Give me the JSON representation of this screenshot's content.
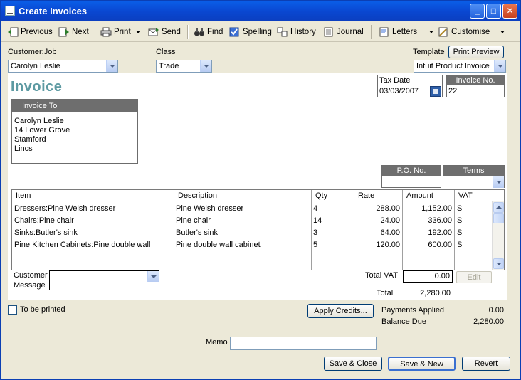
{
  "window": {
    "title": "Create Invoices",
    "min": "_",
    "max": "□",
    "close": "✕"
  },
  "toolbar": {
    "previous": "Previous",
    "next": "Next",
    "print": "Print",
    "send": "Send",
    "find": "Find",
    "spelling": "Spelling",
    "history": "History",
    "journal": "Journal",
    "letters": "Letters",
    "customise": "Customise"
  },
  "header": {
    "customer_job_label": "Customer:Job",
    "customer_job_value": "Carolyn Leslie",
    "class_label": "Class",
    "class_value": "Trade",
    "template_label": "Template",
    "print_preview": "Print Preview",
    "template_value": "Intuit Product Invoice"
  },
  "form": {
    "title": "Invoice",
    "tax_date_label": "Tax Date",
    "tax_date_value": "03/03/2007",
    "invoice_no_label": "Invoice No.",
    "invoice_no_value": "22",
    "invoice_to_label": "Invoice To",
    "invoice_to_lines": [
      "Carolyn Leslie",
      "14 Lower Grove",
      "Stamford",
      "Lincs"
    ],
    "po_label": "P.O. No.",
    "po_value": "",
    "terms_label": "Terms",
    "terms_value": ""
  },
  "items": {
    "columns": [
      "Item",
      "Description",
      "Qty",
      "Rate",
      "Amount",
      "VAT"
    ],
    "rows": [
      {
        "item": "Dressers:Pine Welsh dresser",
        "description": "Pine Welsh dresser",
        "qty": "4",
        "rate": "288.00",
        "amount": "1,152.00",
        "vat": "S"
      },
      {
        "item": "Chairs:Pine chair",
        "description": "Pine chair",
        "qty": "14",
        "rate": "24.00",
        "amount": "336.00",
        "vat": "S"
      },
      {
        "item": "Sinks:Butler's sink",
        "description": "Butler's sink",
        "qty": "3",
        "rate": "64.00",
        "amount": "192.00",
        "vat": "S"
      },
      {
        "item": "Pine Kitchen Cabinets:Pine double wall",
        "description": "Pine double wall cabinet",
        "qty": "5",
        "rate": "120.00",
        "amount": "600.00",
        "vat": "S"
      }
    ]
  },
  "footer": {
    "customer_message_label_1": "Customer",
    "customer_message_label_2": "Message",
    "total_vat_label": "Total VAT",
    "total_vat_value": "0.00",
    "edit_label": "Edit",
    "total_label": "Total",
    "total_value": "2,280.00",
    "to_be_printed": "To be printed",
    "apply_credits": "Apply Credits...",
    "payments_applied_label": "Payments Applied",
    "payments_applied_value": "0.00",
    "balance_due_label": "Balance Due",
    "balance_due_value": "2,280.00",
    "memo_label": "Memo",
    "memo_value": "",
    "save_close": "Save & Close",
    "save_new": "Save & New",
    "revert": "Revert"
  }
}
